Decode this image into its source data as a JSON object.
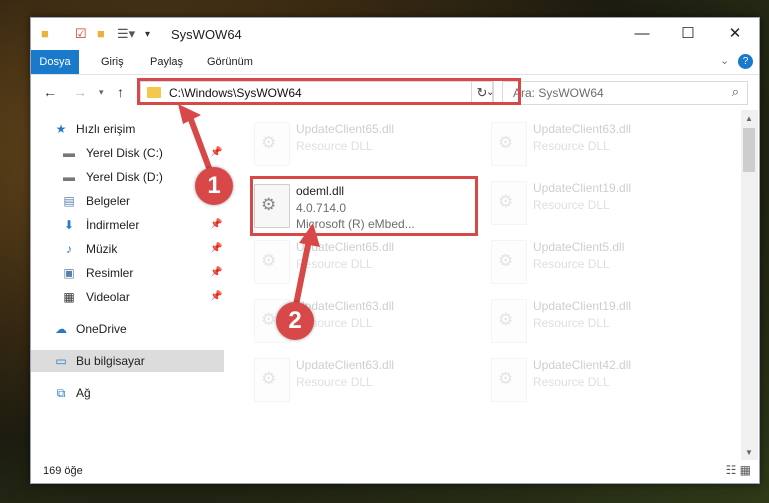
{
  "titlebar": {
    "title": "SysWOW64",
    "minimize_glyph": "—",
    "maximize_glyph": "☐",
    "close_glyph": "✕"
  },
  "ribbon": {
    "tabs": [
      "Dosya",
      "Giriş",
      "Paylaş",
      "Görünüm"
    ],
    "help_glyph": "?"
  },
  "address": {
    "path": "C:\\Windows\\SysWOW64",
    "search_placeholder": "Ara: SysWOW64"
  },
  "sidebar": {
    "items": [
      {
        "label": "Hızlı erişim",
        "icon": "star-icon",
        "glyph": "★",
        "pinned": false
      },
      {
        "label": "Yerel Disk (C:)",
        "icon": "drive-icon",
        "glyph": "▬",
        "pinned": true
      },
      {
        "label": "Yerel Disk (D:)",
        "icon": "drive-icon",
        "glyph": "▬",
        "pinned": true
      },
      {
        "label": "Belgeler",
        "icon": "documents-icon",
        "glyph": "▤",
        "pinned": true
      },
      {
        "label": "İndirmeler",
        "icon": "download-icon",
        "glyph": "⬇",
        "pinned": true
      },
      {
        "label": "Müzik",
        "icon": "music-icon",
        "glyph": "♪",
        "pinned": true
      },
      {
        "label": "Resimler",
        "icon": "pictures-icon",
        "glyph": "▣",
        "pinned": true
      },
      {
        "label": "Videolar",
        "icon": "videos-icon",
        "glyph": "▦",
        "pinned": true
      },
      {
        "label": "OneDrive",
        "icon": "cloud-icon",
        "glyph": "☁",
        "pinned": false
      },
      {
        "label": "Bu bilgisayar",
        "icon": "computer-icon",
        "glyph": "▭",
        "pinned": false
      },
      {
        "label": "Ağ",
        "icon": "network-icon",
        "glyph": "⧉",
        "pinned": false
      }
    ]
  },
  "files": {
    "highlighted": {
      "name": "odeml.dll",
      "version": "4.0.714.0",
      "description": "Microsoft (R) eMbed..."
    },
    "background": [
      {
        "name": "UpdateClient65.dll",
        "type": "Resource DLL"
      },
      {
        "name": "UpdateClient63.dll",
        "type": "Resource DLL"
      },
      {
        "name": "UpdateClient19.dll",
        "type": "Resource DLL"
      },
      {
        "name": "UpdateClient65.dll",
        "type": "Resource DLL"
      },
      {
        "name": "UpdateClient5.dll",
        "type": "Resource DLL"
      },
      {
        "name": "UpdateClient63.dll",
        "type": "Resource DLL"
      },
      {
        "name": "UpdateClient19.dll",
        "type": "Resource DLL"
      },
      {
        "name": "UpdateClient63.dll",
        "type": "Resource DLL"
      },
      {
        "name": "UpdateClient42.dll",
        "type": "Resource DLL"
      }
    ]
  },
  "status": {
    "item_count": "169 öğe"
  },
  "annotations": {
    "step1": "1",
    "step2": "2"
  },
  "colors": {
    "accent": "#1979ca",
    "highlight_red": "#d94848",
    "selected_bg": "#dcdcdc"
  }
}
